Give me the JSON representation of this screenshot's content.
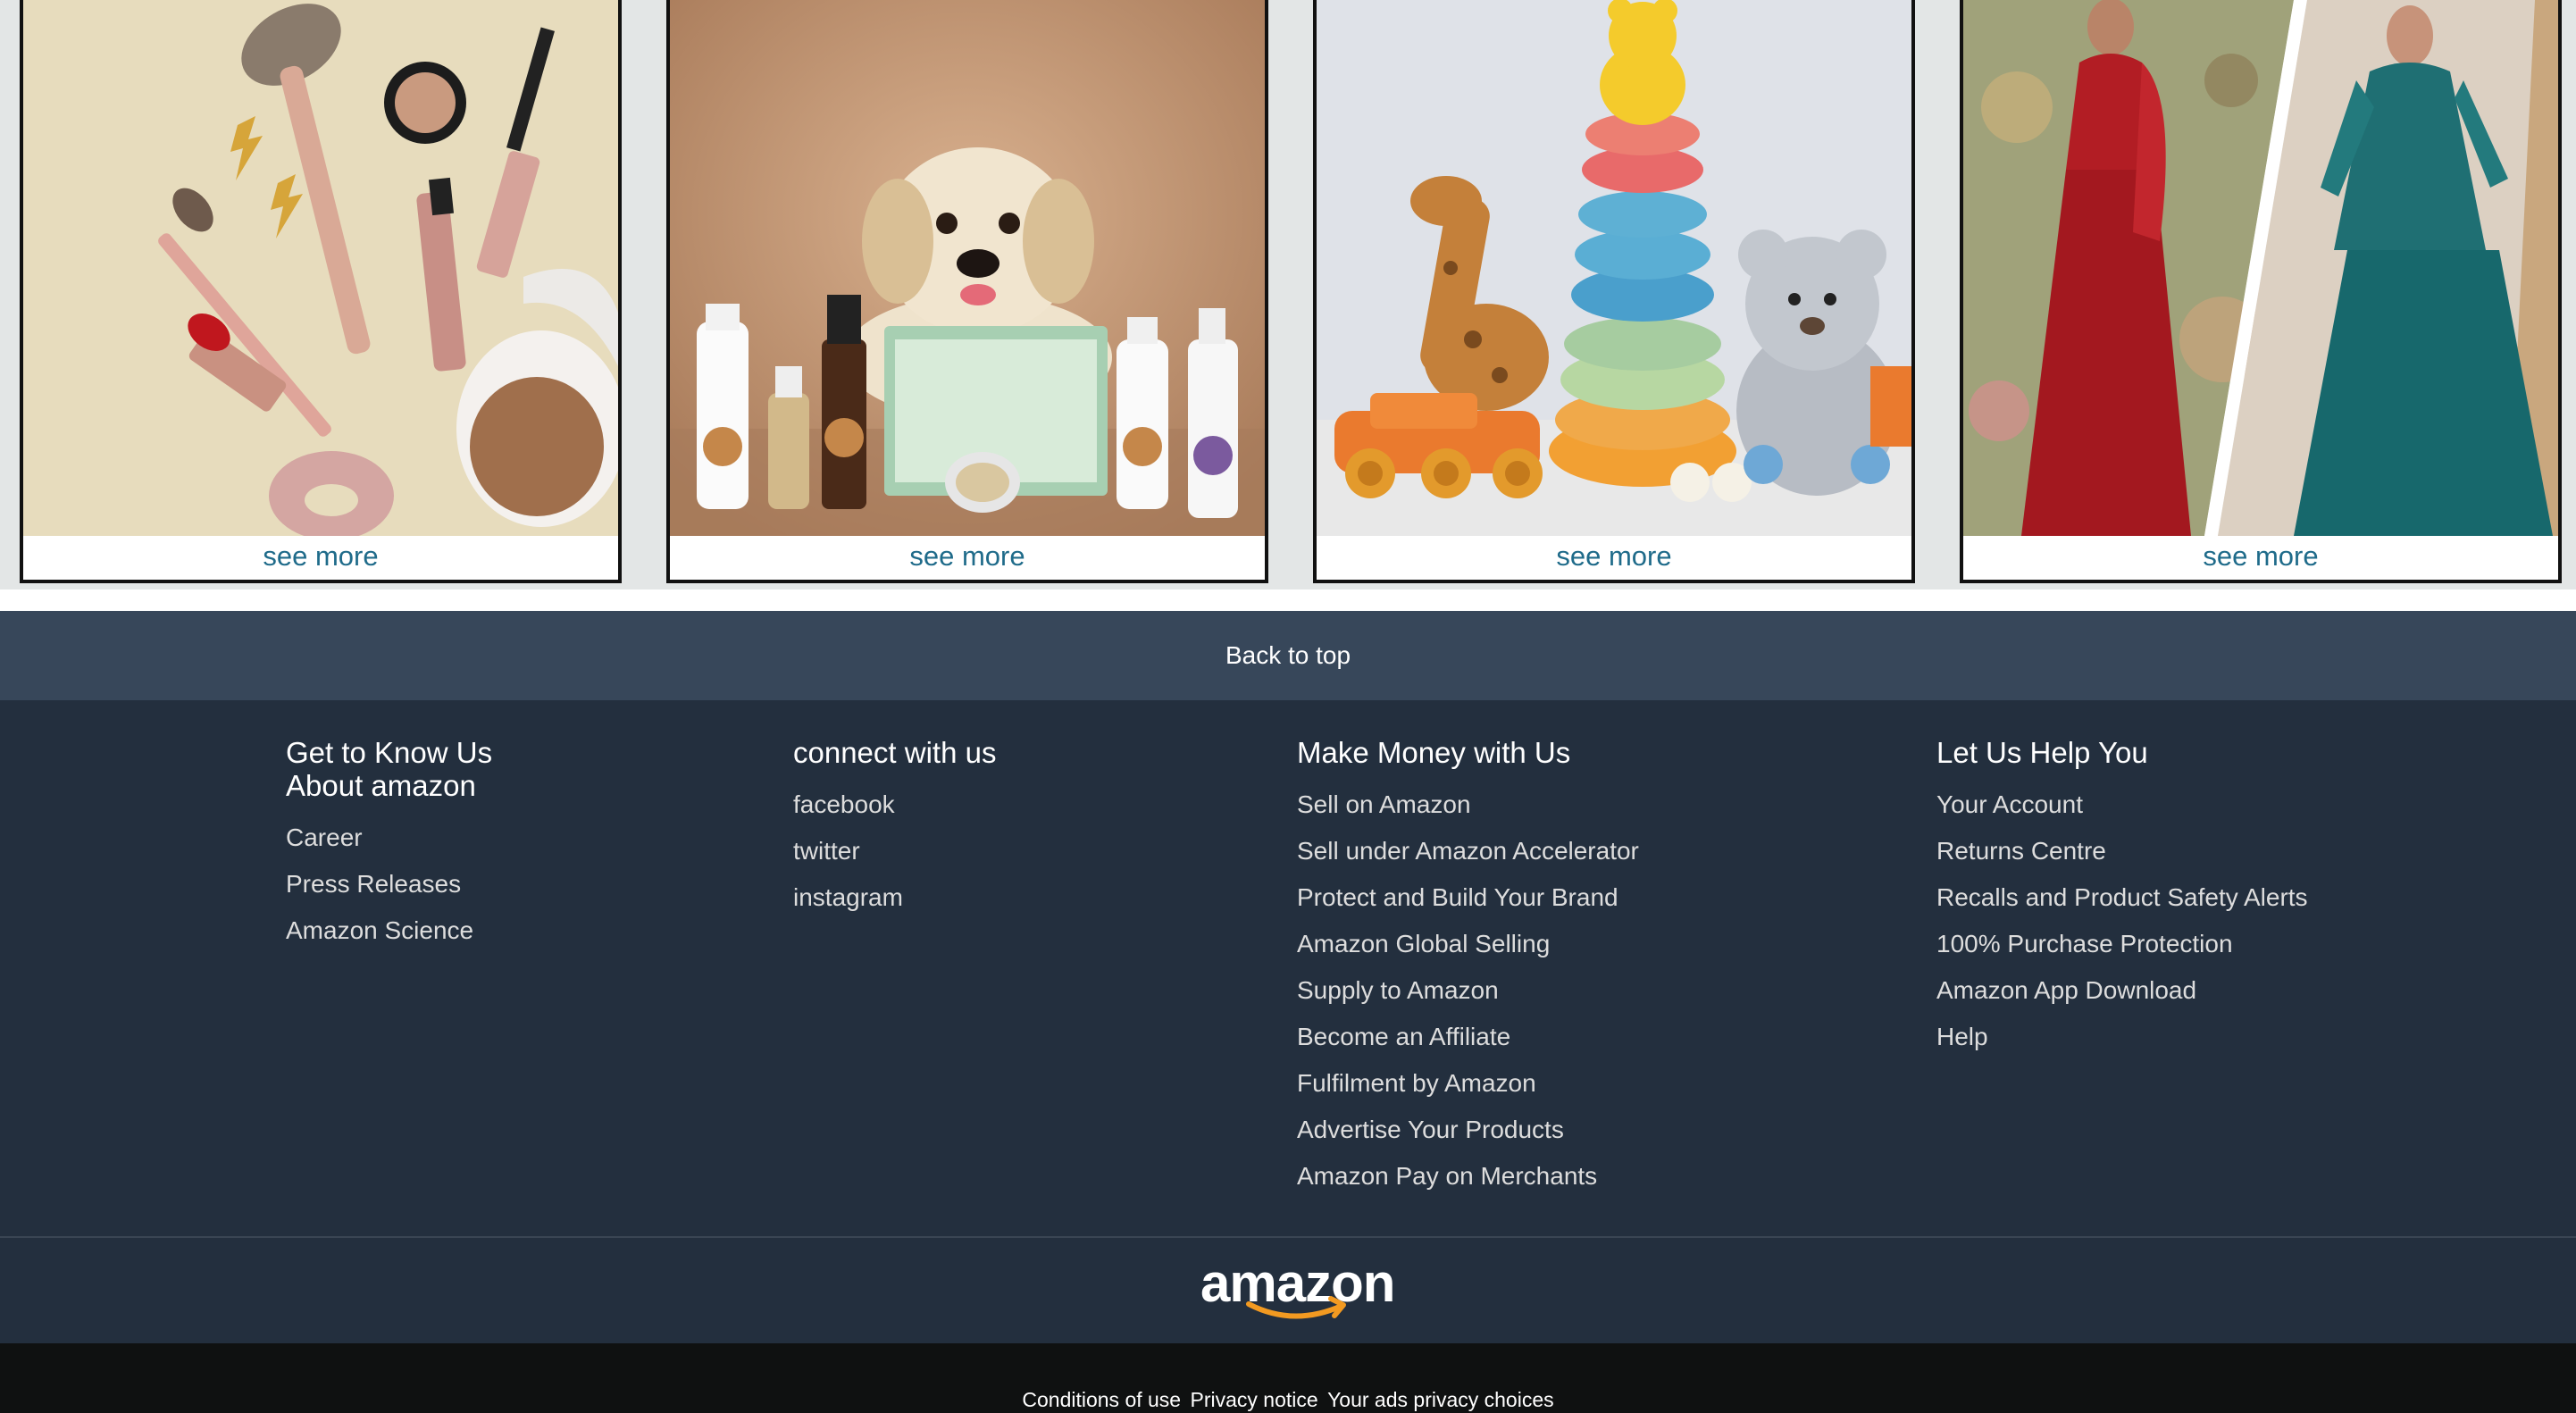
{
  "tiles": [
    {
      "label": "see more",
      "image": "makeup-products"
    },
    {
      "label": "see more",
      "image": "puppy-pet-care-products"
    },
    {
      "label": "see more",
      "image": "toys-giraffe-stacking-rings-teddy"
    },
    {
      "label": "see more",
      "image": "ethnic-womens-fashion"
    }
  ],
  "back_to_top": "Back to top",
  "footer": {
    "columns": [
      {
        "title": "Get to Know Us",
        "subtitle": "About amazon",
        "links": [
          "Career",
          "Press Releases",
          "Amazon Science"
        ]
      },
      {
        "title": "connect with us",
        "links": [
          "facebook",
          "twitter",
          "instagram"
        ]
      },
      {
        "title": "Make Money with Us",
        "links": [
          "Sell on Amazon",
          "Sell under Amazon Accelerator",
          "Protect and Build Your Brand",
          "Amazon Global Selling",
          "Supply to Amazon",
          "Become an Affiliate",
          "Fulfilment by Amazon",
          "Advertise Your Products",
          "Amazon Pay on Merchants"
        ]
      },
      {
        "title": "Let Us Help You",
        "links": [
          "Your Account",
          "Returns Centre",
          "Recalls and Product Safety Alerts",
          "100% Purchase Protection",
          "Amazon App Download",
          "Help"
        ]
      }
    ],
    "logo_text": "amazon",
    "legal": [
      "Conditions of use",
      "Privacy notice",
      "Your ads privacy choices"
    ]
  },
  "colors": {
    "accent_link": "#1f6b8a",
    "back_to_top_bg": "#37475a",
    "footer_bg": "#232f3e",
    "bottom_bg": "#0f1111",
    "logo_smile": "#f29a21"
  }
}
